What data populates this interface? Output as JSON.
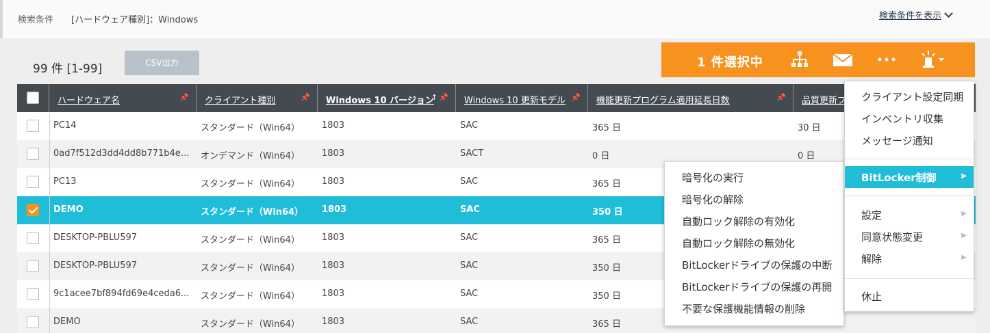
{
  "search": {
    "label": "検索条件",
    "value": "[ハードウェア種別]：Windows",
    "toggle": "検索条件を表示"
  },
  "result": {
    "count": "99 件  [1-99]",
    "csv_button": "CSV出力"
  },
  "action_bar": {
    "selected_label": "1 件選択中",
    "icons": [
      "network-icon",
      "mail-icon",
      "more-icon",
      "alarm-icon"
    ]
  },
  "table": {
    "columns": [
      "ハードウェア名",
      "クライアント種別",
      "Windows 10 バージョン",
      "Windows 10 更新モデル",
      "機能更新プログラム適用延長日数",
      "品質更新プ"
    ],
    "sorted_column_indicator": "↑",
    "rows": [
      {
        "checked": false,
        "cells": [
          "PC14",
          "スタンダード（Win64）",
          "1803",
          "SAC",
          "365 日",
          "30 日"
        ]
      },
      {
        "checked": false,
        "cells": [
          "0ad7f512d3dd4dd8b771b4ee...",
          "オンデマンド（Win64）",
          "1803",
          "SACT",
          "0 日",
          "0 日"
        ]
      },
      {
        "checked": false,
        "cells": [
          "PC13",
          "スタンダード（Win64）",
          "1803",
          "SAC",
          "365 日",
          ""
        ]
      },
      {
        "checked": true,
        "cells": [
          "DEMO",
          "スタンダード（Win64）",
          "1803",
          "SAC",
          "350 日",
          ""
        ]
      },
      {
        "checked": false,
        "cells": [
          "DESKTOP-PBLU597",
          "スタンダード（Win64）",
          "1803",
          "SAC",
          "365 日",
          ""
        ]
      },
      {
        "checked": false,
        "cells": [
          "DESKTOP-PBLU597",
          "スタンダード（Win64）",
          "1803",
          "SAC",
          "350 日",
          ""
        ]
      },
      {
        "checked": false,
        "cells": [
          "9c1acee7bf894fd69e4ceda6...",
          "スタンダード（Win64）",
          "1803",
          "SAC",
          "350 日",
          ""
        ]
      },
      {
        "checked": false,
        "cells": [
          "DEMO",
          "スタンダード（Win64）",
          "1803",
          "SAC",
          "365 日",
          ""
        ]
      }
    ]
  },
  "menu": {
    "group1": [
      "クライアント設定同期",
      "インベントリ収集",
      "メッセージ通知"
    ],
    "highlighted": "BitLocker制御",
    "group3": [
      "設定",
      "同意状態変更",
      "解除"
    ],
    "group4": [
      "休止"
    ]
  },
  "submenu": {
    "items": [
      "暗号化の実行",
      "暗号化の解除",
      "自動ロック解除の有効化",
      "自動ロック解除の無効化",
      "BitLockerドライブの保護の中断",
      "BitLockerドライブの保護の再開",
      "不要な保護機能情報の削除"
    ]
  },
  "colors": {
    "accent_orange": "#f7921e",
    "selection_cyan": "#1fbdd8",
    "header_dark": "#434a50"
  }
}
